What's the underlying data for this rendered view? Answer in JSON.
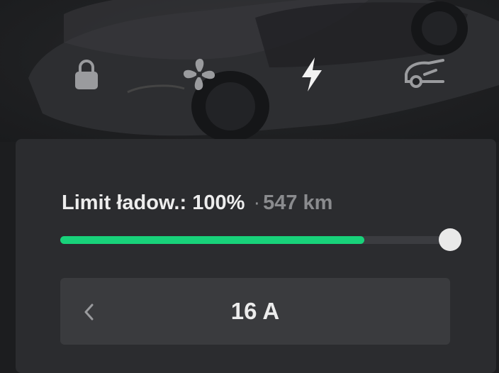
{
  "icons": {
    "lock": "lock-icon",
    "climate": "fan-icon",
    "charging": "lightning-icon",
    "trunk": "car-trunk-icon"
  },
  "charge": {
    "label": "Limit ładow.:",
    "percent": "100%",
    "separator": "·",
    "range": "547 km",
    "slider_fill_fraction": 0.78
  },
  "amperage": {
    "value": "16 A",
    "prev_icon": "chevron-left-icon"
  },
  "colors": {
    "accent_green": "#18d27a",
    "background": "#1c1d1f",
    "panel": "#2b2c2f"
  }
}
